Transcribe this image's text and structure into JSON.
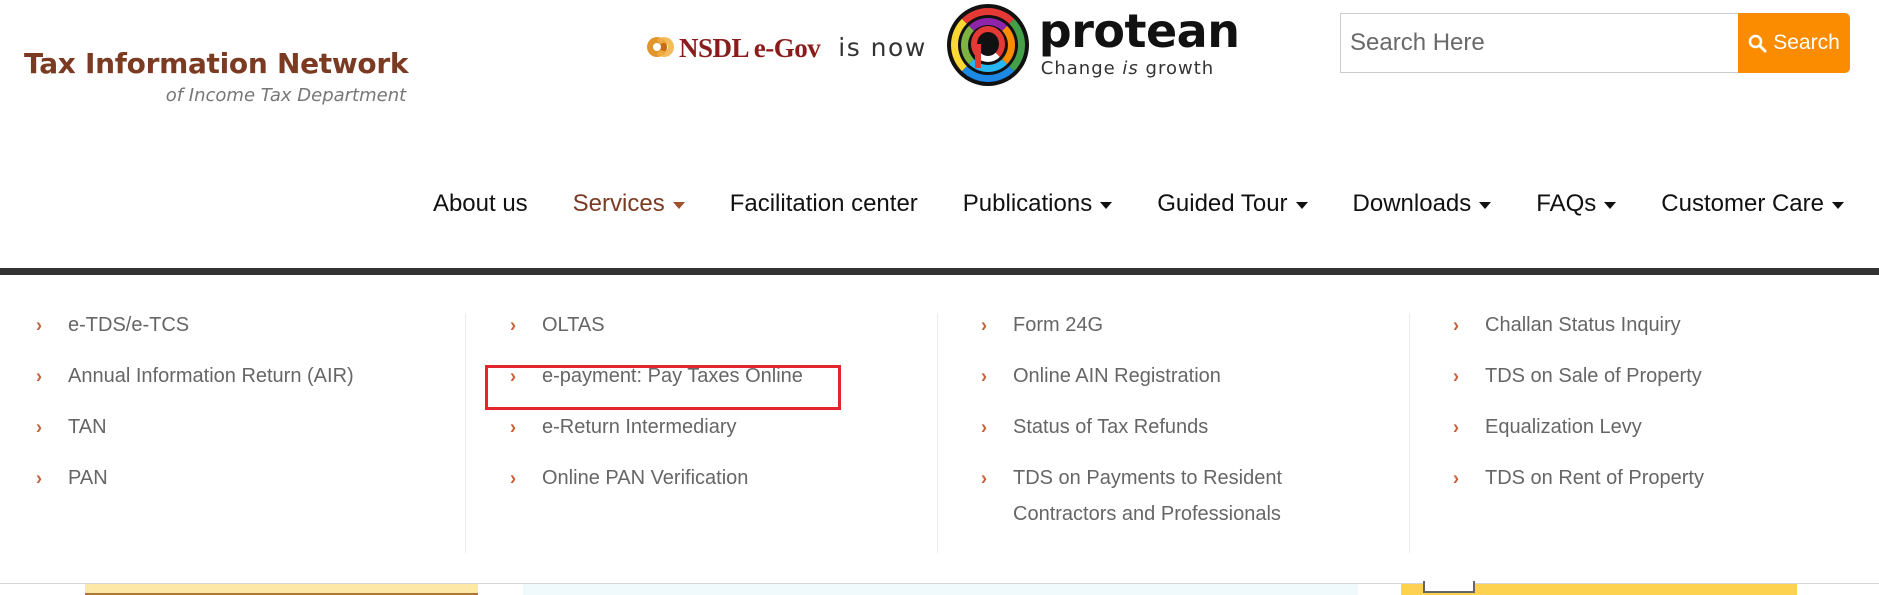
{
  "header": {
    "brand_title": "Tax Information Network",
    "brand_subtitle": "of Income Tax Department",
    "partner": {
      "old_name": "NSDL e-Gov",
      "connector": "is now",
      "new_name": "protean",
      "tagline_pre": "Change ",
      "tagline_em": "is",
      "tagline_post": " growth"
    },
    "search": {
      "placeholder": "Search Here",
      "value": "",
      "button_label": "Search",
      "button_color": "#fb8c00"
    }
  },
  "nav": {
    "items": [
      {
        "label": "About us",
        "has_dropdown": false,
        "active": false
      },
      {
        "label": "Services",
        "has_dropdown": true,
        "active": true
      },
      {
        "label": "Facilitation center",
        "has_dropdown": false,
        "active": false
      },
      {
        "label": "Publications",
        "has_dropdown": true,
        "active": false
      },
      {
        "label": "Guided Tour",
        "has_dropdown": true,
        "active": false
      },
      {
        "label": "Downloads",
        "has_dropdown": true,
        "active": false
      },
      {
        "label": "FAQs",
        "has_dropdown": true,
        "active": false
      },
      {
        "label": "Customer Care",
        "has_dropdown": true,
        "active": false
      }
    ],
    "active_color": "#7a3b22"
  },
  "services_menu": {
    "columns": [
      {
        "items": [
          "e-TDS/e-TCS",
          "Annual Information Return (AIR)",
          "TAN",
          "PAN"
        ]
      },
      {
        "items": [
          "OLTAS",
          "e-payment: Pay Taxes Online",
          "e-Return Intermediary",
          "Online PAN Verification"
        ]
      },
      {
        "items": [
          "Form 24G",
          "Online AIN Registration",
          "Status of Tax Refunds",
          "TDS on Payments to Resident Contractors and Professionals"
        ]
      },
      {
        "items": [
          "Challan Status Inquiry",
          "TDS on Sale of Property",
          "Equalization Levy",
          "TDS on Rent of Property"
        ]
      }
    ],
    "highlighted_item": "e-payment: Pay Taxes Online",
    "highlight_color": "#e3262e",
    "chevron_color": "#c8623a"
  }
}
